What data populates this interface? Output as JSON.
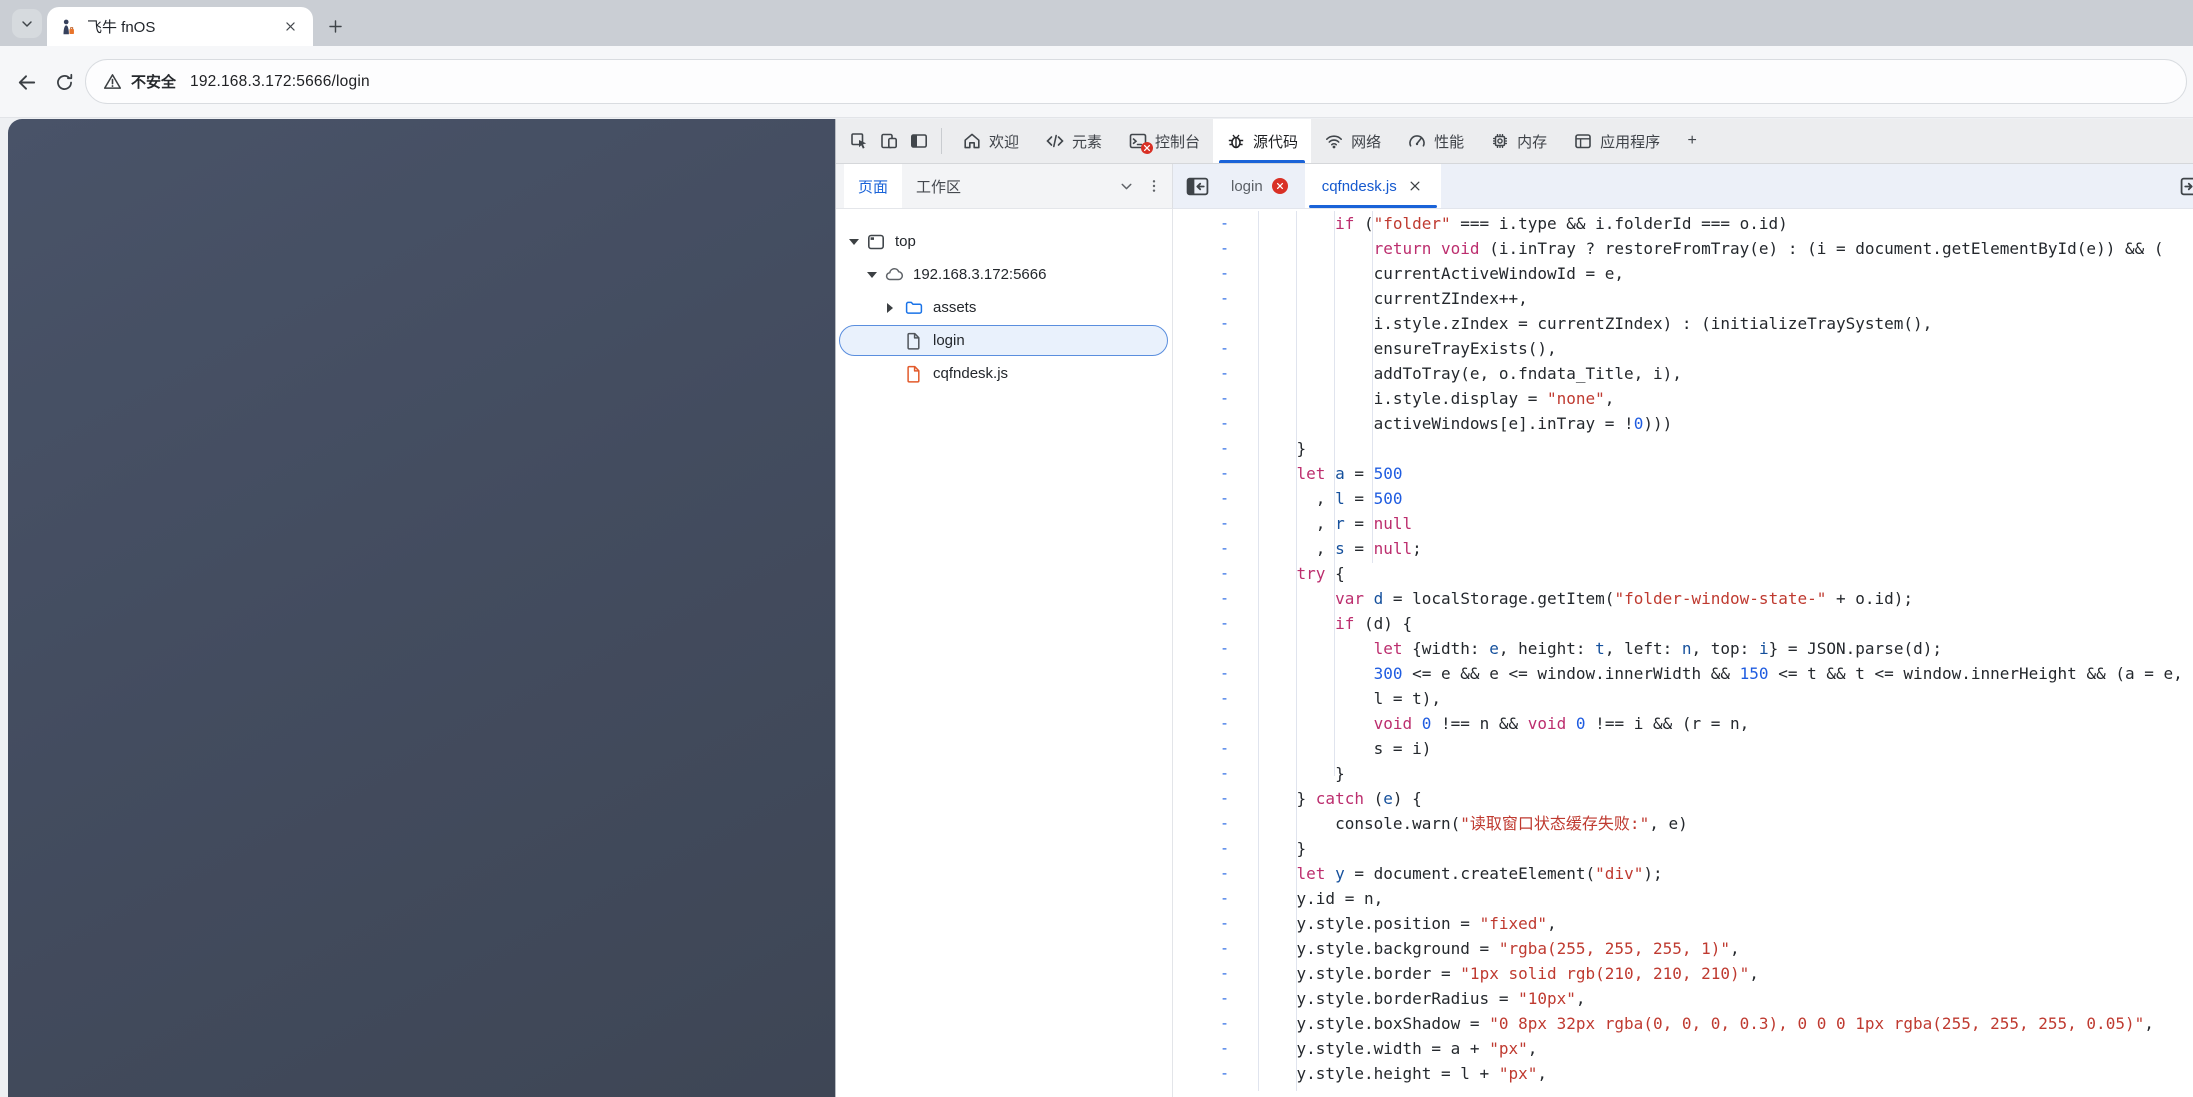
{
  "browser": {
    "tab_title": "飞牛 fnOS",
    "new_tab_label": "+",
    "security_label": "不安全",
    "url": "192.168.3.172:5666/login"
  },
  "devtools": {
    "toolbar": {
      "buttons": [
        {
          "icon": "inspect-icon"
        },
        {
          "icon": "device-toolbar-icon"
        },
        {
          "icon": "dock-side-icon"
        }
      ],
      "tabs": [
        {
          "label": "欢迎",
          "icon": "home-icon",
          "active": false,
          "error_badge": false
        },
        {
          "label": "元素",
          "icon": "elements-icon",
          "active": false,
          "error_badge": false
        },
        {
          "label": "控制台",
          "icon": "console-icon",
          "active": false,
          "error_badge": true
        },
        {
          "label": "源代码",
          "icon": "sources-icon",
          "active": true,
          "error_badge": false
        },
        {
          "label": "网络",
          "icon": "network-icon",
          "active": false,
          "error_badge": false
        },
        {
          "label": "性能",
          "icon": "performance-icon",
          "active": false,
          "error_badge": false
        },
        {
          "label": "内存",
          "icon": "memory-icon",
          "active": false,
          "error_badge": false
        },
        {
          "label": "应用程序",
          "icon": "application-icon",
          "active": false,
          "error_badge": false
        }
      ],
      "more_tabs_label": "+"
    },
    "navigator": {
      "tabs": [
        {
          "label": "页面",
          "active": true
        },
        {
          "label": "工作区",
          "active": false
        }
      ],
      "tree": [
        {
          "label": "top",
          "icon": "frame-icon",
          "expander": "open",
          "depth": 0,
          "selected": false
        },
        {
          "label": "192.168.3.172:5666",
          "icon": "cloud-icon",
          "expander": "open",
          "depth": 1,
          "selected": false
        },
        {
          "label": "assets",
          "icon": "folder-icon",
          "expander": "closed",
          "depth": 2,
          "selected": false
        },
        {
          "label": "login",
          "icon": "file-icon-gray",
          "expander": "none",
          "depth": 2,
          "selected": true
        },
        {
          "label": "cqfndesk.js",
          "icon": "file-icon-orange",
          "expander": "none",
          "depth": 2,
          "selected": false
        }
      ]
    },
    "editor": {
      "tabs": [
        {
          "label": "login",
          "active": false,
          "error_badge": true,
          "closable": false
        },
        {
          "label": "cqfndesk.js",
          "active": true,
          "error_badge": false,
          "closable": true
        }
      ],
      "gutter_marker": "-",
      "code_lines": [
        [
          [
            "p",
            "        "
          ],
          [
            "k",
            "if"
          ],
          [
            "p",
            " ("
          ],
          [
            "s",
            "\"folder\""
          ],
          [
            "p",
            " === i.type && i.folderId === o.id)"
          ]
        ],
        [
          [
            "p",
            "            "
          ],
          [
            "k",
            "return"
          ],
          [
            "p",
            " "
          ],
          [
            "k",
            "void"
          ],
          [
            "p",
            " (i.inTray ? restoreFromTray(e) : (i = document.getElementById(e)) && ("
          ]
        ],
        [
          [
            "p",
            "            currentActiveWindowId = e,"
          ]
        ],
        [
          [
            "p",
            "            currentZIndex++,"
          ]
        ],
        [
          [
            "p",
            "            i.style.zIndex = currentZIndex) : (initializeTraySystem(),"
          ]
        ],
        [
          [
            "p",
            "            ensureTrayExists(),"
          ]
        ],
        [
          [
            "p",
            "            addToTray(e, o.fndata_Title, i),"
          ]
        ],
        [
          [
            "p",
            "            i.style.display = "
          ],
          [
            "s",
            "\"none\""
          ],
          [
            "p",
            ","
          ]
        ],
        [
          [
            "p",
            "            activeWindows[e].inTray = !"
          ],
          [
            "n",
            "0"
          ],
          [
            "p",
            ")))"
          ]
        ],
        [
          [
            "p",
            "    }"
          ]
        ],
        [
          [
            "p",
            "    "
          ],
          [
            "k",
            "let"
          ],
          [
            "p",
            " "
          ],
          [
            "d",
            "a"
          ],
          [
            "p",
            " = "
          ],
          [
            "n",
            "500"
          ]
        ],
        [
          [
            "p",
            "      , "
          ],
          [
            "d",
            "l"
          ],
          [
            "p",
            " = "
          ],
          [
            "n",
            "500"
          ]
        ],
        [
          [
            "p",
            "      , "
          ],
          [
            "d",
            "r"
          ],
          [
            "p",
            " = "
          ],
          [
            "k",
            "null"
          ]
        ],
        [
          [
            "p",
            "      , "
          ],
          [
            "d",
            "s"
          ],
          [
            "p",
            " = "
          ],
          [
            "k",
            "null"
          ],
          [
            "p",
            ";"
          ]
        ],
        [
          [
            "p",
            "    "
          ],
          [
            "k",
            "try"
          ],
          [
            "p",
            " {"
          ]
        ],
        [
          [
            "p",
            "        "
          ],
          [
            "k",
            "var"
          ],
          [
            "p",
            " "
          ],
          [
            "d",
            "d"
          ],
          [
            "p",
            " = localStorage.getItem("
          ],
          [
            "s",
            "\"folder-window-state-\""
          ],
          [
            "p",
            " + o.id);"
          ]
        ],
        [
          [
            "p",
            "        "
          ],
          [
            "k",
            "if"
          ],
          [
            "p",
            " (d) {"
          ]
        ],
        [
          [
            "p",
            "            "
          ],
          [
            "k",
            "let"
          ],
          [
            "p",
            " {width: "
          ],
          [
            "d",
            "e"
          ],
          [
            "p",
            ", height: "
          ],
          [
            "d",
            "t"
          ],
          [
            "p",
            ", left: "
          ],
          [
            "d",
            "n"
          ],
          [
            "p",
            ", top: "
          ],
          [
            "d",
            "i"
          ],
          [
            "p",
            "} = JSON.parse(d);"
          ]
        ],
        [
          [
            "p",
            "            "
          ],
          [
            "n",
            "300"
          ],
          [
            "p",
            " <= e && e <= window.innerWidth && "
          ],
          [
            "n",
            "150"
          ],
          [
            "p",
            " <= t && t <= window.innerHeight && (a = e,"
          ]
        ],
        [
          [
            "p",
            "            l = t),"
          ]
        ],
        [
          [
            "p",
            "            "
          ],
          [
            "k",
            "void"
          ],
          [
            "p",
            " "
          ],
          [
            "n",
            "0"
          ],
          [
            "p",
            " !== n && "
          ],
          [
            "k",
            "void"
          ],
          [
            "p",
            " "
          ],
          [
            "n",
            "0"
          ],
          [
            "p",
            " !== i && (r = n,"
          ]
        ],
        [
          [
            "p",
            "            s = i)"
          ]
        ],
        [
          [
            "p",
            "        }"
          ]
        ],
        [
          [
            "p",
            "    } "
          ],
          [
            "k",
            "catch"
          ],
          [
            "p",
            " ("
          ],
          [
            "d",
            "e"
          ],
          [
            "p",
            ") {"
          ]
        ],
        [
          [
            "p",
            "        console.warn("
          ],
          [
            "s",
            "\"读取窗口状态缓存失败:\""
          ],
          [
            "p",
            ", e)"
          ]
        ],
        [
          [
            "p",
            "    }"
          ]
        ],
        [
          [
            "p",
            "    "
          ],
          [
            "k",
            "let"
          ],
          [
            "p",
            " "
          ],
          [
            "d",
            "y"
          ],
          [
            "p",
            " = document.createElement("
          ],
          [
            "s",
            "\"div\""
          ],
          [
            "p",
            ");"
          ]
        ],
        [
          [
            "p",
            "    y.id = n,"
          ]
        ],
        [
          [
            "p",
            "    y.style.position = "
          ],
          [
            "s",
            "\"fixed\""
          ],
          [
            "p",
            ","
          ]
        ],
        [
          [
            "p",
            "    y.style.background = "
          ],
          [
            "s",
            "\"rgba(255, 255, 255, 1)\""
          ],
          [
            "p",
            ","
          ]
        ],
        [
          [
            "p",
            "    y.style.border = "
          ],
          [
            "s",
            "\"1px solid rgb(210, 210, 210)\""
          ],
          [
            "p",
            ","
          ]
        ],
        [
          [
            "p",
            "    y.style.borderRadius = "
          ],
          [
            "s",
            "\"10px\""
          ],
          [
            "p",
            ","
          ]
        ],
        [
          [
            "p",
            "    y.style.boxShadow = "
          ],
          [
            "s",
            "\"0 8px 32px rgba(0, 0, 0, 0.3), 0 0 0 1px rgba(255, 255, 255, 0.05)\""
          ],
          [
            "p",
            ","
          ]
        ],
        [
          [
            "p",
            "    y.style.width = a + "
          ],
          [
            "s",
            "\"px\""
          ],
          [
            "p",
            ","
          ]
        ],
        [
          [
            "p",
            "    y.style.height = l + "
          ],
          [
            "s",
            "\"px\""
          ],
          [
            "p",
            ","
          ]
        ]
      ]
    },
    "palette": {
      "accent_blue": "#1a63d8",
      "error_red": "#d93025",
      "token_keyword": "#bc2e6e",
      "token_number": "#1f5ce0",
      "token_string": "#bf3a30",
      "token_variable": "#15509c",
      "token_plain": "#24282d",
      "gutter_mark_blue": "#2e6de5",
      "folder_blue": "#1a73e8",
      "file_orange": "#e25a2b"
    }
  }
}
